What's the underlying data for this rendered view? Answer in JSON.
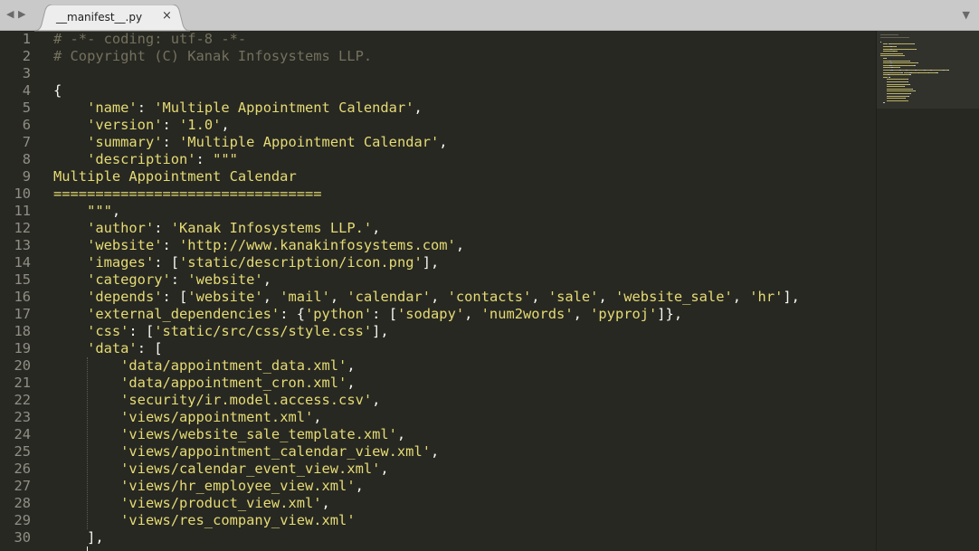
{
  "tabbar": {
    "tab": {
      "title": "__manifest__.py",
      "close_glyph": "×"
    },
    "back_glyph": "◀",
    "forward_glyph": "▶",
    "dropdown_glyph": "▼"
  },
  "colors": {
    "editor_bg": "#272822",
    "comment": "#75715e",
    "string": "#e6db74",
    "text": "#f8f8f2",
    "line_number": "#908e85",
    "tabbar_bg": "#c9c9c9",
    "tab_active_bg": "#ededed"
  },
  "editor": {
    "lines": [
      {
        "n": "1",
        "tokens": [
          {
            "t": "# -*- coding: utf-8 -*-",
            "k": "comment"
          }
        ]
      },
      {
        "n": "2",
        "tokens": [
          {
            "t": "# Copyright (C) Kanak Infosystems LLP.",
            "k": "comment"
          }
        ]
      },
      {
        "n": "3",
        "tokens": []
      },
      {
        "n": "4",
        "tokens": [
          {
            "t": "{",
            "k": "text"
          }
        ]
      },
      {
        "n": "5",
        "tokens": [
          {
            "t": "    ",
            "k": "text"
          },
          {
            "t": "'name'",
            "k": "string"
          },
          {
            "t": ": ",
            "k": "text"
          },
          {
            "t": "'Multiple Appointment Calendar'",
            "k": "string"
          },
          {
            "t": ",",
            "k": "text"
          }
        ]
      },
      {
        "n": "6",
        "tokens": [
          {
            "t": "    ",
            "k": "text"
          },
          {
            "t": "'version'",
            "k": "string"
          },
          {
            "t": ": ",
            "k": "text"
          },
          {
            "t": "'1.0'",
            "k": "string"
          },
          {
            "t": ",",
            "k": "text"
          }
        ]
      },
      {
        "n": "7",
        "tokens": [
          {
            "t": "    ",
            "k": "text"
          },
          {
            "t": "'summary'",
            "k": "string"
          },
          {
            "t": ": ",
            "k": "text"
          },
          {
            "t": "'Multiple Appointment Calendar'",
            "k": "string"
          },
          {
            "t": ",",
            "k": "text"
          }
        ]
      },
      {
        "n": "8",
        "tokens": [
          {
            "t": "    ",
            "k": "text"
          },
          {
            "t": "'description'",
            "k": "string"
          },
          {
            "t": ": ",
            "k": "text"
          },
          {
            "t": "\"\"\"",
            "k": "string"
          }
        ]
      },
      {
        "n": "9",
        "tokens": [
          {
            "t": "Multiple Appointment Calendar",
            "k": "string"
          }
        ]
      },
      {
        "n": "10",
        "tokens": [
          {
            "t": "================================",
            "k": "string"
          }
        ]
      },
      {
        "n": "11",
        "tokens": [
          {
            "t": "    ",
            "k": "text"
          },
          {
            "t": "\"\"\"",
            "k": "string"
          },
          {
            "t": ",",
            "k": "text"
          }
        ]
      },
      {
        "n": "12",
        "tokens": [
          {
            "t": "    ",
            "k": "text"
          },
          {
            "t": "'author'",
            "k": "string"
          },
          {
            "t": ": ",
            "k": "text"
          },
          {
            "t": "'Kanak Infosystems LLP.'",
            "k": "string"
          },
          {
            "t": ",",
            "k": "text"
          }
        ]
      },
      {
        "n": "13",
        "tokens": [
          {
            "t": "    ",
            "k": "text"
          },
          {
            "t": "'website'",
            "k": "string"
          },
          {
            "t": ": ",
            "k": "text"
          },
          {
            "t": "'http://www.kanakinfosystems.com'",
            "k": "string"
          },
          {
            "t": ",",
            "k": "text"
          }
        ]
      },
      {
        "n": "14",
        "tokens": [
          {
            "t": "    ",
            "k": "text"
          },
          {
            "t": "'images'",
            "k": "string"
          },
          {
            "t": ": [",
            "k": "text"
          },
          {
            "t": "'static/description/icon.png'",
            "k": "string"
          },
          {
            "t": "],",
            "k": "text"
          }
        ]
      },
      {
        "n": "15",
        "tokens": [
          {
            "t": "    ",
            "k": "text"
          },
          {
            "t": "'category'",
            "k": "string"
          },
          {
            "t": ": ",
            "k": "text"
          },
          {
            "t": "'website'",
            "k": "string"
          },
          {
            "t": ",",
            "k": "text"
          }
        ]
      },
      {
        "n": "16",
        "tokens": [
          {
            "t": "    ",
            "k": "text"
          },
          {
            "t": "'depends'",
            "k": "string"
          },
          {
            "t": ": [",
            "k": "text"
          },
          {
            "t": "'website'",
            "k": "string"
          },
          {
            "t": ", ",
            "k": "text"
          },
          {
            "t": "'mail'",
            "k": "string"
          },
          {
            "t": ", ",
            "k": "text"
          },
          {
            "t": "'calendar'",
            "k": "string"
          },
          {
            "t": ", ",
            "k": "text"
          },
          {
            "t": "'contacts'",
            "k": "string"
          },
          {
            "t": ", ",
            "k": "text"
          },
          {
            "t": "'sale'",
            "k": "string"
          },
          {
            "t": ", ",
            "k": "text"
          },
          {
            "t": "'website_sale'",
            "k": "string"
          },
          {
            "t": ", ",
            "k": "text"
          },
          {
            "t": "'hr'",
            "k": "string"
          },
          {
            "t": "],",
            "k": "text"
          }
        ]
      },
      {
        "n": "17",
        "tokens": [
          {
            "t": "    ",
            "k": "text"
          },
          {
            "t": "'external_dependencies'",
            "k": "string"
          },
          {
            "t": ": {",
            "k": "text"
          },
          {
            "t": "'python'",
            "k": "string"
          },
          {
            "t": ": [",
            "k": "text"
          },
          {
            "t": "'sodapy'",
            "k": "string"
          },
          {
            "t": ", ",
            "k": "text"
          },
          {
            "t": "'num2words'",
            "k": "string"
          },
          {
            "t": ", ",
            "k": "text"
          },
          {
            "t": "'pyproj'",
            "k": "string"
          },
          {
            "t": "]},",
            "k": "text"
          }
        ]
      },
      {
        "n": "18",
        "tokens": [
          {
            "t": "    ",
            "k": "text"
          },
          {
            "t": "'css'",
            "k": "string"
          },
          {
            "t": ": [",
            "k": "text"
          },
          {
            "t": "'static/src/css/style.css'",
            "k": "string"
          },
          {
            "t": "],",
            "k": "text"
          }
        ]
      },
      {
        "n": "19",
        "tokens": [
          {
            "t": "    ",
            "k": "text"
          },
          {
            "t": "'data'",
            "k": "string"
          },
          {
            "t": ": [",
            "k": "text"
          }
        ]
      },
      {
        "n": "20",
        "tokens": [
          {
            "t": "        ",
            "k": "text"
          },
          {
            "t": "'data/appointment_data.xml'",
            "k": "string"
          },
          {
            "t": ",",
            "k": "text"
          }
        ]
      },
      {
        "n": "21",
        "tokens": [
          {
            "t": "        ",
            "k": "text"
          },
          {
            "t": "'data/appointment_cron.xml'",
            "k": "string"
          },
          {
            "t": ",",
            "k": "text"
          }
        ]
      },
      {
        "n": "22",
        "tokens": [
          {
            "t": "        ",
            "k": "text"
          },
          {
            "t": "'security/ir.model.access.csv'",
            "k": "string"
          },
          {
            "t": ",",
            "k": "text"
          }
        ]
      },
      {
        "n": "23",
        "tokens": [
          {
            "t": "        ",
            "k": "text"
          },
          {
            "t": "'views/appointment.xml'",
            "k": "string"
          },
          {
            "t": ",",
            "k": "text"
          }
        ]
      },
      {
        "n": "24",
        "tokens": [
          {
            "t": "        ",
            "k": "text"
          },
          {
            "t": "'views/website_sale_template.xml'",
            "k": "string"
          },
          {
            "t": ",",
            "k": "text"
          }
        ]
      },
      {
        "n": "25",
        "tokens": [
          {
            "t": "        ",
            "k": "text"
          },
          {
            "t": "'views/appointment_calendar_view.xml'",
            "k": "string"
          },
          {
            "t": ",",
            "k": "text"
          }
        ]
      },
      {
        "n": "26",
        "tokens": [
          {
            "t": "        ",
            "k": "text"
          },
          {
            "t": "'views/calendar_event_view.xml'",
            "k": "string"
          },
          {
            "t": ",",
            "k": "text"
          }
        ]
      },
      {
        "n": "27",
        "tokens": [
          {
            "t": "        ",
            "k": "text"
          },
          {
            "t": "'views/hr_employee_view.xml'",
            "k": "string"
          },
          {
            "t": ",",
            "k": "text"
          }
        ]
      },
      {
        "n": "28",
        "tokens": [
          {
            "t": "        ",
            "k": "text"
          },
          {
            "t": "'views/product_view.xml'",
            "k": "string"
          },
          {
            "t": ",",
            "k": "text"
          }
        ]
      },
      {
        "n": "29",
        "tokens": [
          {
            "t": "        ",
            "k": "text"
          },
          {
            "t": "'views/res_company_view.xml'",
            "k": "string"
          }
        ]
      },
      {
        "n": "30",
        "tokens": [
          {
            "t": "    ",
            "k": "text"
          },
          {
            "t": "],",
            "k": "text"
          }
        ]
      }
    ]
  }
}
